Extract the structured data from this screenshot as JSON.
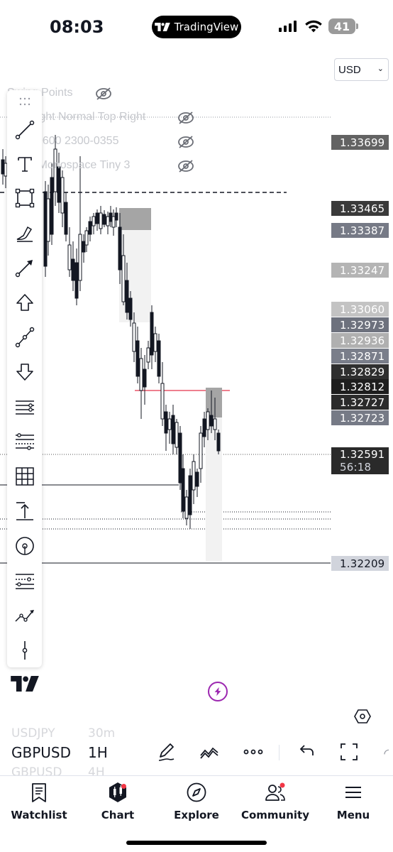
{
  "status": {
    "time": "08:03",
    "pill_label": "TradingView",
    "battery": "41"
  },
  "currency": {
    "value": "USD"
  },
  "legend": [
    {
      "text": "Swing Points"
    },
    {
      "text": "Top Right Normal Top Right"
    },
    {
      "text": "0300-0600 2300-0355"
    },
    {
      "text": "Label Monospace Tiny 3"
    }
  ],
  "price_scale": [
    {
      "price": "1.33699",
      "color": "#636363"
    },
    {
      "price": "1.33465",
      "color": "#3a3a3a"
    },
    {
      "price": "1.33387",
      "color": "#767a86"
    },
    {
      "price": "1.33247",
      "color": "#b4b4b4"
    },
    {
      "price": "1.33060",
      "color": "#c3c3c3"
    },
    {
      "price": "1.32973",
      "color": "#6d717d"
    },
    {
      "price": "1.32936",
      "color": "#b0b0b0"
    },
    {
      "price": "1.32871",
      "color": "#7a7e8a"
    },
    {
      "price": "1.32829",
      "color": "#2f2f2f"
    },
    {
      "price": "1.32812",
      "color": "#1e1e1e"
    },
    {
      "price": "1.32727",
      "color": "#2b2b2b"
    },
    {
      "price": "1.32723",
      "color": "#767a86"
    }
  ],
  "last_price": {
    "price": "1.32591",
    "countdown": "56:18"
  },
  "bottom_price": {
    "price": "1.32209"
  },
  "symbol_strip": {
    "prev_symbol": "USDJPY",
    "prev_tf": "30m",
    "symbol": "GBPUSD",
    "timeframe": "1H",
    "next_symbol": "GBPUSD",
    "next_tf": "4H"
  },
  "nav": [
    {
      "label": "Watchlist",
      "icon": "watchlist-icon"
    },
    {
      "label": "Chart",
      "icon": "chart-icon"
    },
    {
      "label": "Explore",
      "icon": "compass-icon"
    },
    {
      "label": "Community",
      "icon": "community-icon"
    },
    {
      "label": "Menu",
      "icon": "menu-icon"
    }
  ],
  "colors": {
    "accent_purple": "#9c27b0",
    "notification_red": "#f23645",
    "red_level": "#e8566a"
  }
}
